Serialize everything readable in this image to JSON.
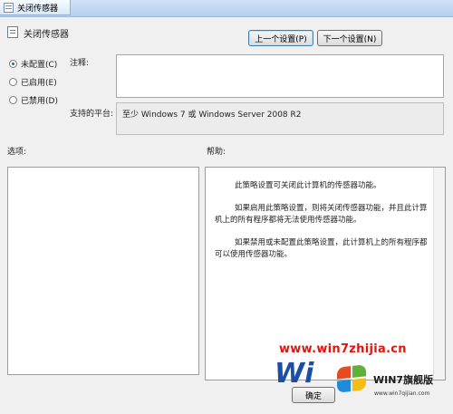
{
  "window": {
    "title": "关闭传感器"
  },
  "header": {
    "title": "关闭传感器"
  },
  "nav": {
    "prev_label": "上一个设置(P)",
    "next_label": "下一个设置(N)"
  },
  "state": {
    "options": [
      {
        "label": "未配置(C)",
        "selected": true
      },
      {
        "label": "已启用(E)",
        "selected": false
      },
      {
        "label": "已禁用(D)",
        "selected": false
      }
    ]
  },
  "comment": {
    "label": "注释:",
    "value": ""
  },
  "platform": {
    "label": "支持的平台:",
    "value": "至少 Windows 7 或 Windows Server 2008 R2"
  },
  "options_pane": {
    "label": "选项:"
  },
  "help_pane": {
    "label": "帮助:",
    "paragraphs": [
      "此策略设置可关闭此计算机的传感器功能。",
      "如果启用此策略设置，则将关闭传感器功能，并且此计算机上的所有程序都将无法使用传感器功能。",
      "如果禁用或未配置此策略设置，此计算机上的所有程序都可以使用传感器功能。"
    ]
  },
  "footer": {
    "ok_label": "确定"
  },
  "watermark": {
    "url": "www.win7zhijia.cn",
    "logo_text": "Wi",
    "brand": "WIN7旗舰版",
    "site": "www.win7qijian.com"
  }
}
